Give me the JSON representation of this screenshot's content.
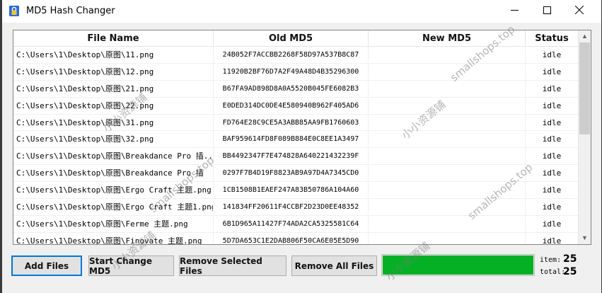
{
  "window": {
    "title": "MD5 Hash Changer"
  },
  "table": {
    "headers": {
      "file_name": "File Name",
      "old_md5": "Old MD5",
      "new_md5": "New MD5",
      "status": "Status"
    },
    "rows": [
      {
        "file": "C:\\Users\\1\\Desktop\\原图\\11.png",
        "old": "24B052F7ACCBB2268F58D97A537B8C87",
        "new": "",
        "status": "idle"
      },
      {
        "file": "C:\\Users\\1\\Desktop\\原图\\12.png",
        "old": "11920B2BF76D7A2F49A48D4B35296300",
        "new": "",
        "status": "idle"
      },
      {
        "file": "C:\\Users\\1\\Desktop\\原图\\21.png",
        "old": "B67FA9AD898D8A0A5520B045FE6082B3",
        "new": "",
        "status": "idle"
      },
      {
        "file": "C:\\Users\\1\\Desktop\\原图\\22.png",
        "old": "E0DED314DC0DE4E580940B962F405AD6",
        "new": "",
        "status": "idle"
      },
      {
        "file": "C:\\Users\\1\\Desktop\\原图\\31.png",
        "old": "FD764E28C9CE5A3ABB85AA9FB1760603",
        "new": "",
        "status": "idle"
      },
      {
        "file": "C:\\Users\\1\\Desktop\\原图\\32.png",
        "old": "BAF959614FD8F089B884E0C8EE1A3497",
        "new": "",
        "status": "idle"
      },
      {
        "file": "C:\\Users\\1\\Desktop\\原图\\Breakdance Pro 插...",
        "old": "BB4492347F7E474828A640221432239F",
        "new": "",
        "status": "idle"
      },
      {
        "file": "C:\\Users\\1\\Desktop\\原图\\Breakdance Pro 插",
        "old": "0297F7B4D19F8823AB9A97D4A7345CD0",
        "new": "",
        "status": "idle"
      },
      {
        "file": "C:\\Users\\1\\Desktop\\原图\\Ergo Craft 主题.png",
        "old": "1CB1508B1EAEF247A83B50786A104A60",
        "new": "",
        "status": "idle"
      },
      {
        "file": "C:\\Users\\1\\Desktop\\原图\\Ergo Craft 主题1.png",
        "old": "141834FF20611F4CCBF2D23D0EE48352",
        "new": "",
        "status": "idle"
      },
      {
        "file": "C:\\Users\\1\\Desktop\\原图\\Ferme 主题.png",
        "old": "6B1D965A11427F74ADA2CA5325581C64",
        "new": "",
        "status": "idle"
      },
      {
        "file": "C:\\Users\\1\\Desktop\\原图\\Finovate 主题.png",
        "old": "5D7DA653C1E2DAB806F50CA6E05E5D90",
        "new": "",
        "status": "idle"
      }
    ]
  },
  "toolbar": {
    "add_files": "Add Files",
    "start_change": "Start Change MD5",
    "remove_selected": "Remove Selected Files",
    "remove_all": "Remove All Files"
  },
  "progress": {
    "value": 1.0,
    "color": "#06b025"
  },
  "counts": {
    "item_label": "item:",
    "item_value": "25",
    "total_label": "total:",
    "total_value": "25"
  },
  "watermarks": {
    "cn": "小小资源铺",
    "en": "smallshops.top"
  },
  "icons": {
    "app": "lock-icon",
    "minimize": "minimize-icon",
    "maximize": "maximize-icon",
    "close": "close-icon"
  }
}
